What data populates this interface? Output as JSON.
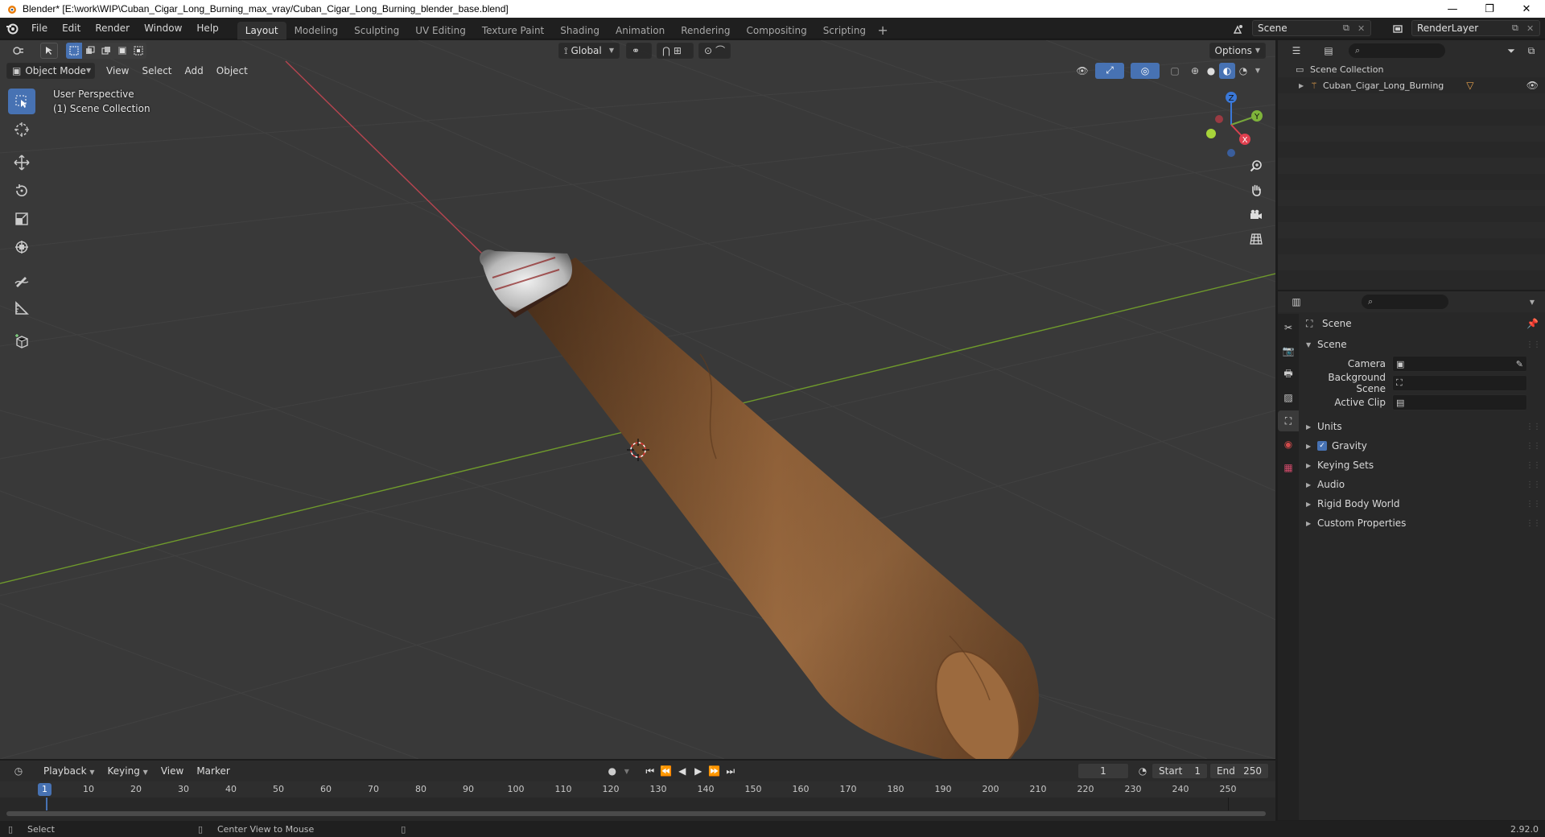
{
  "window": {
    "title": "Blender* [E:\\work\\WIP\\Cuban_Cigar_Long_Burning_max_vray/Cuban_Cigar_Long_Burning_blender_base.blend]",
    "minimize": "—",
    "maximize": "❐",
    "close": "✕"
  },
  "menu": [
    "File",
    "Edit",
    "Render",
    "Window",
    "Help"
  ],
  "workspaces": {
    "tabs": [
      "Layout",
      "Modeling",
      "Sculpting",
      "UV Editing",
      "Texture Paint",
      "Shading",
      "Animation",
      "Rendering",
      "Compositing",
      "Scripting"
    ],
    "active": "Layout",
    "add": "+"
  },
  "scene_selector": {
    "value": "Scene"
  },
  "view_layer_selector": {
    "value": "RenderLayer"
  },
  "viewport": {
    "transform_orientation": "Global",
    "options": "Options",
    "mode": "Object Mode",
    "menus": [
      "View",
      "Select",
      "Add",
      "Object"
    ],
    "overlay_line1": "User Perspective",
    "overlay_line2": "(1) Scene Collection",
    "gizmo": {
      "z": "Z",
      "y": "Y",
      "x": "X"
    },
    "colors": {
      "background": "#393939",
      "x_axis": "#c2454f",
      "y_axis": "#7ea63a",
      "accent": "#4772b3"
    }
  },
  "outliner": {
    "root": "Scene Collection",
    "items": [
      {
        "name": "Cuban_Cigar_Long_Burning"
      }
    ]
  },
  "properties": {
    "header": "Scene",
    "section": "Scene",
    "fields": [
      {
        "label": "Camera",
        "value": ""
      },
      {
        "label": "Background Scene",
        "value": ""
      },
      {
        "label": "Active Clip",
        "value": ""
      }
    ],
    "panels": [
      {
        "label": "Units",
        "checkbox": false
      },
      {
        "label": "Gravity",
        "checkbox": true
      },
      {
        "label": "Keying Sets",
        "checkbox": false
      },
      {
        "label": "Audio",
        "checkbox": false
      },
      {
        "label": "Rigid Body World",
        "checkbox": false
      },
      {
        "label": "Custom Properties",
        "checkbox": false
      }
    ]
  },
  "timeline": {
    "menus": [
      "Playback",
      "Keying",
      "View",
      "Marker"
    ],
    "current_frame": "1",
    "start_label": "Start",
    "start": "1",
    "end_label": "End",
    "end": "250",
    "ticks": [
      "10",
      "20",
      "30",
      "40",
      "50",
      "60",
      "70",
      "80",
      "90",
      "100",
      "110",
      "120",
      "130",
      "140",
      "150",
      "160",
      "170",
      "180",
      "190",
      "200",
      "210",
      "220",
      "230",
      "240",
      "250"
    ],
    "cursor_label": "1"
  },
  "statusbar": {
    "select": "Select",
    "center_view": "Center View to Mouse",
    "version": "2.92.0"
  }
}
